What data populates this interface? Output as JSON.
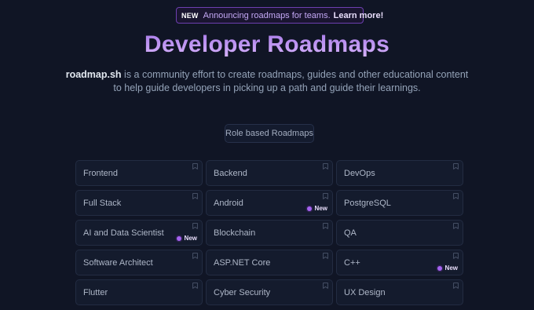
{
  "announcement": {
    "badge": "NEW",
    "text": "Announcing roadmaps for teams.",
    "link": "Learn more!"
  },
  "hero": {
    "title": "Developer Roadmaps",
    "brand": "roadmap.sh",
    "description": " is a community effort to create roadmaps, guides and other educational content to help guide developers in picking up a path and guide their learnings."
  },
  "section": {
    "label": "Role based Roadmaps"
  },
  "roadmaps": [
    {
      "label": "Frontend",
      "new": ""
    },
    {
      "label": "Backend",
      "new": ""
    },
    {
      "label": "DevOps",
      "new": ""
    },
    {
      "label": "Full Stack",
      "new": ""
    },
    {
      "label": "Android",
      "new": "New"
    },
    {
      "label": "PostgreSQL",
      "new": ""
    },
    {
      "label": "AI and Data Scientist",
      "new": "New"
    },
    {
      "label": "Blockchain",
      "new": ""
    },
    {
      "label": "QA",
      "new": ""
    },
    {
      "label": "Software Architect",
      "new": ""
    },
    {
      "label": "ASP.NET Core",
      "new": ""
    },
    {
      "label": "C++",
      "new": "New"
    },
    {
      "label": "Flutter",
      "new": ""
    },
    {
      "label": "Cyber Security",
      "new": ""
    },
    {
      "label": "UX Design",
      "new": ""
    }
  ],
  "icons": {
    "card_action": "bookmark-icon",
    "new_marker": "purple-dot-icon"
  },
  "colors": {
    "background": "#101525",
    "accent": "#c08ef5",
    "new_dot": "#a463f0"
  }
}
